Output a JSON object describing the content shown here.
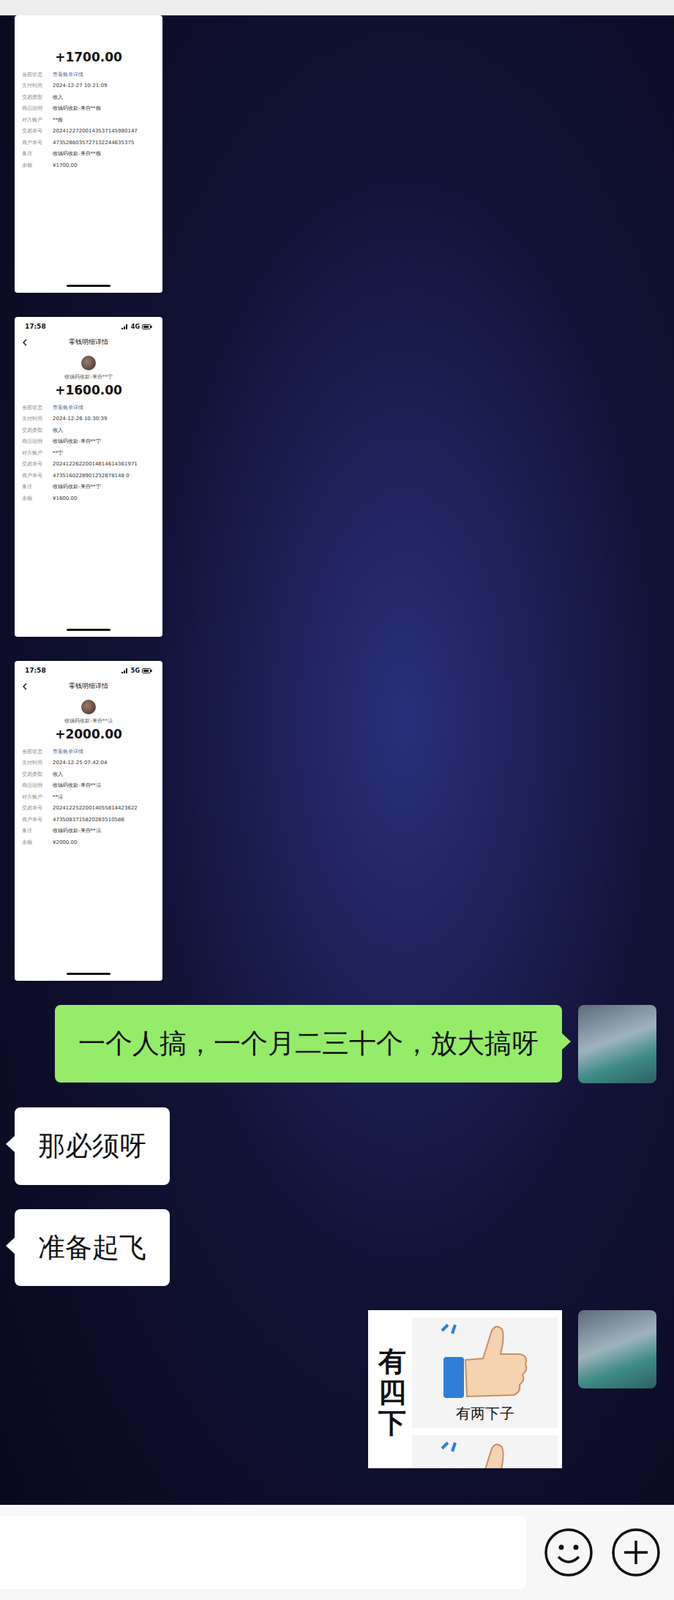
{
  "chat": {
    "messages": [
      {
        "kind": "screenshot",
        "side": "left",
        "amount": "+1700.00",
        "rows": [
          [
            "当前状态",
            "查看账单详情"
          ],
          [
            "支付时间",
            "2024-12-27 10:21:09"
          ],
          [
            "交易类型",
            "收入"
          ],
          [
            "商品说明",
            "收钱码收款-来自**薇"
          ],
          [
            "对方账户",
            "**薇"
          ],
          [
            "交易单号",
            "20241227200143537145980147"
          ],
          [
            "商户单号",
            "4735286035727132244635375"
          ],
          [
            "备注",
            "收钱码收款-来自**薇"
          ],
          [
            "余额",
            "¥1700.00"
          ]
        ]
      },
      {
        "kind": "screenshot",
        "side": "left",
        "time": "17:58",
        "network": "4G",
        "title": "零钱明细详情",
        "payer": "收钱码收款-来自**宁",
        "amount": "+1600.00",
        "rows": [
          [
            "当前状态",
            "查看账单详情"
          ],
          [
            "支付时间",
            "2024-12-26 10:30:39"
          ],
          [
            "交易类型",
            "收入"
          ],
          [
            "商品说明",
            "收钱码收款-来自**宁"
          ],
          [
            "对方账户",
            "**宁"
          ],
          [
            "交易单号",
            "20241226220014814614361971"
          ],
          [
            "商户单号",
            "4735160228901232878148 0"
          ],
          [
            "备注",
            "收钱码收款-来自**宁"
          ],
          [
            "余额",
            "¥1600.00"
          ]
        ]
      },
      {
        "kind": "screenshot",
        "side": "left",
        "time": "17:58",
        "network": "5G",
        "title": "零钱明细详情",
        "payer": "收钱码收款-来自**洁",
        "amount": "+2000.00",
        "rows": [
          [
            "当前状态",
            "查看账单详情"
          ],
          [
            "支付时间",
            "2024-12-25 07:42:04"
          ],
          [
            "交易类型",
            "收入"
          ],
          [
            "商品说明",
            "收钱码收款-来自**洁"
          ],
          [
            "对方账户",
            "**洁"
          ],
          [
            "交易单号",
            "20241225220014055814423622"
          ],
          [
            "商户单号",
            "4735083715820283510586"
          ],
          [
            "备注",
            "收钱码收款-来自**洁"
          ],
          [
            "余额",
            "¥2000.00"
          ]
        ]
      },
      {
        "kind": "text",
        "side": "right",
        "text": "一个人搞，一个月二三十个，放大搞呀"
      },
      {
        "kind": "text",
        "side": "left",
        "text": "那必须呀"
      },
      {
        "kind": "text",
        "side": "left",
        "text": "准备起飞"
      },
      {
        "kind": "sticker",
        "side": "right",
        "vertical_text": "有四下",
        "caption": "有两下子"
      }
    ]
  }
}
